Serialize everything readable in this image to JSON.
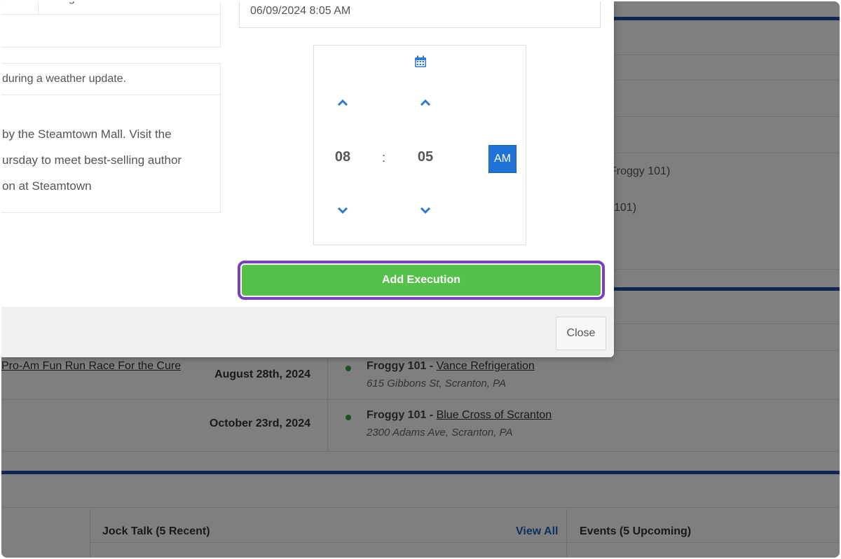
{
  "background": {
    "right_fragments": [
      {
        "text": "Froggy 101)"
      },
      {
        "text": "101)"
      }
    ],
    "events": [
      {
        "title": "Pro-Am Fun Run Race For the Cure",
        "date": "August 28th, 2024",
        "station": "Froggy 101 - ",
        "location_name": "Vance Refrigeration",
        "address": "615 Gibbons St, Scranton, PA"
      },
      {
        "title": "",
        "date": "October 23rd, 2024",
        "station": "Froggy 101 - ",
        "location_name": "Blue Cross of Scranton",
        "address": "2300 Adams Ave, Scranton, PA"
      }
    ],
    "panels": {
      "jock_talk_title": "Jock Talk (5 Recent)",
      "view_all": "View All",
      "events_title": "Events (5 Upcoming)"
    },
    "colors": {
      "rule": "#1f4ea1",
      "status_dot": "#3aa34a"
    }
  },
  "modal": {
    "top_left_fragment": "g",
    "message_header": "during a weather update.",
    "message_lines": [
      "by the Steamtown Mall. Visit the",
      "ursday to meet best-selling author",
      "on at Steamtown"
    ],
    "datetime_value": "06/09/2024 8:05 AM",
    "time_picker": {
      "hour": "08",
      "separator": ":",
      "minute": "05",
      "period": "AM",
      "icons": {
        "calendar": "calendar-icon",
        "hour_up": "chevron-up-icon",
        "minute_up": "chevron-up-icon",
        "hour_down": "chevron-down-icon",
        "minute_down": "chevron-down-icon"
      }
    },
    "add_execution_label": "Add Execution",
    "close_label": "Close",
    "colors": {
      "add_button": "#55c14a",
      "highlight": "#7a3fc0",
      "period_active": "#1f73d6",
      "icon": "#2f78d0"
    }
  }
}
